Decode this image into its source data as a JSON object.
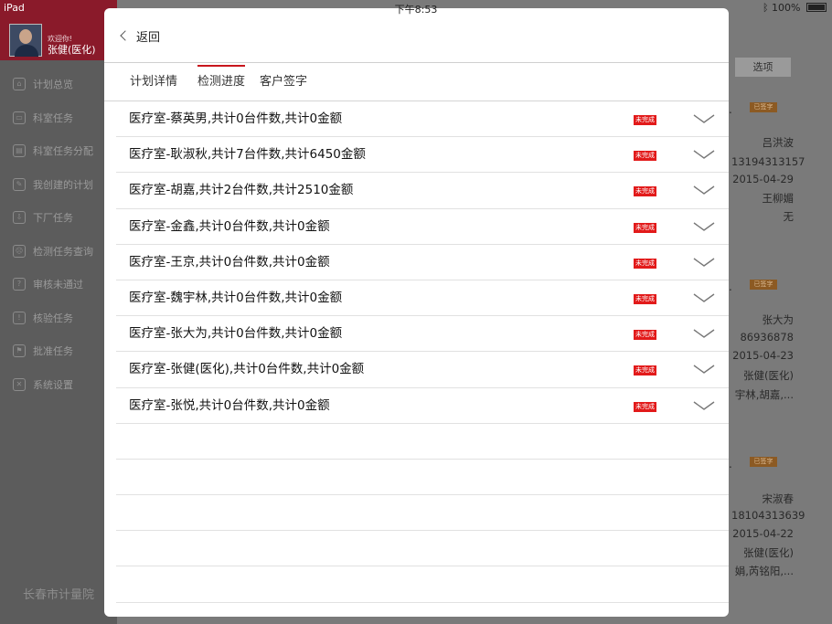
{
  "status_bar": {
    "device": "iPad",
    "time": "下午8:53",
    "battery": "100%"
  },
  "sidebar": {
    "welcome": "欢迎你!",
    "username": "张健(医化)",
    "items": [
      {
        "label": "计划总览",
        "icon": "home-icon"
      },
      {
        "label": "科室任务",
        "icon": "wallet-icon"
      },
      {
        "label": "科室任务分配",
        "icon": "box-icon"
      },
      {
        "label": "我创建的计划",
        "icon": "edit-icon"
      },
      {
        "label": "下厂任务",
        "icon": "inbox-icon"
      },
      {
        "label": "检测任务查询",
        "icon": "face-icon"
      },
      {
        "label": "审核未通过",
        "icon": "question-icon"
      },
      {
        "label": "核验任务",
        "icon": "info-icon"
      },
      {
        "label": "批准任务",
        "icon": "stamp-icon"
      },
      {
        "label": "系统设置",
        "icon": "tools-icon"
      }
    ],
    "org": "长春市计量院"
  },
  "background": {
    "select_label": "选项",
    "cards": [
      {
        "badge": "已签字",
        "lines": [
          "吕洪波",
          "13194313157",
          "2015-04-29",
          "王柳媚",
          "无"
        ]
      },
      {
        "badge": "已签字",
        "lines": [
          "张大为",
          "86936878",
          "2015-04-23",
          "张健(医化)",
          "宇林,胡嘉,..."
        ]
      },
      {
        "badge": "已签字",
        "lines": [
          "宋淑春",
          "18104313639",
          "2015-04-22",
          "张健(医化)",
          "娟,芮铭阳,..."
        ]
      }
    ]
  },
  "modal": {
    "back_label": "返回",
    "tabs": [
      {
        "label": "计划详情",
        "active": false
      },
      {
        "label": "检测进度",
        "active": true
      },
      {
        "label": "客户签字",
        "active": false
      }
    ],
    "rows": [
      {
        "text": "医疗室-蔡英男,共计0台件数,共计0金额",
        "status": "未完成"
      },
      {
        "text": "医疗室-耿淑秋,共计7台件数,共计6450金额",
        "status": "未完成"
      },
      {
        "text": "医疗室-胡嘉,共计2台件数,共计2510金额",
        "status": "未完成"
      },
      {
        "text": "医疗室-金鑫,共计0台件数,共计0金额",
        "status": "未完成"
      },
      {
        "text": "医疗室-王京,共计0台件数,共计0金额",
        "status": "未完成"
      },
      {
        "text": "医疗室-魏宇林,共计0台件数,共计0金额",
        "status": "未完成"
      },
      {
        "text": "医疗室-张大为,共计0台件数,共计0金额",
        "status": "未完成"
      },
      {
        "text": "医疗室-张健(医化),共计0台件数,共计0金额",
        "status": "未完成"
      },
      {
        "text": "医疗室-张悦,共计0台件数,共计0金额",
        "status": "未完成"
      }
    ],
    "accent_color": "#c8161d",
    "status_color": "#e21a1a"
  }
}
